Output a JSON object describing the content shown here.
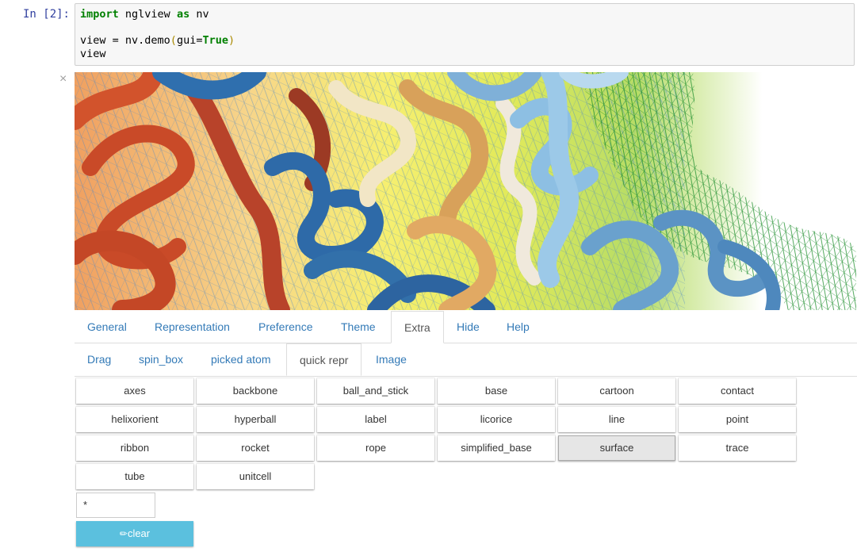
{
  "cell": {
    "prompt": "In [2]:",
    "code": {
      "line1": {
        "kw1": "import",
        "mid": " nglview ",
        "kw2": "as",
        "tail": " nv"
      },
      "line3": {
        "pre": "view = nv.demo",
        "open": "(",
        "arg": "gui=",
        "val": "True",
        "close": ")"
      },
      "line4": "view"
    }
  },
  "close_symbol": "×",
  "tabs": [
    {
      "label": "General"
    },
    {
      "label": "Representation"
    },
    {
      "label": "Preference"
    },
    {
      "label": "Theme"
    },
    {
      "label": "Extra",
      "active": true
    },
    {
      "label": "Hide"
    },
    {
      "label": "Help"
    }
  ],
  "subtabs": [
    {
      "label": "Drag"
    },
    {
      "label": "spin_box"
    },
    {
      "label": "picked atom"
    },
    {
      "label": "quick repr",
      "active": true
    },
    {
      "label": "Image"
    }
  ],
  "repr_buttons": [
    "axes",
    "backbone",
    "ball_and_stick",
    "base",
    "cartoon",
    "contact",
    "helixorient",
    "hyperball",
    "label",
    "licorice",
    "line",
    "point",
    "ribbon",
    "rocket",
    "rope",
    "simplified_base",
    "surface",
    "trace",
    "tube",
    "unitcell"
  ],
  "selected_repr": "surface",
  "selection_input": "*",
  "clear_button": {
    "icon": "eraser-icon",
    "label": "clear"
  },
  "colors": {
    "accent": "#337ab7",
    "clear_bg": "#5bc0de",
    "keyword": "#008000",
    "prompt": "#303f9f"
  }
}
